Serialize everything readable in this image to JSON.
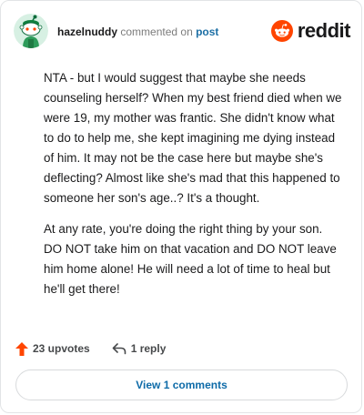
{
  "comment": {
    "username": "hazelnuddy",
    "action_text": "commented on",
    "post_link": "post",
    "paragraphs": [
      "NTA - but I would suggest that maybe she needs counseling herself? When my best friend died when we were 19, my mother was frantic. She didn't know what to do to help me, she kept imagining me dying instead of him. It may not be the case here but maybe she's deflecting? Almost like she's mad that this happened to someone her son's age..? It's a thought.",
      "At any rate, you're doing the right thing by your son. DO NOT take him on that vacation and DO NOT leave him home alone! He will need a lot of time to heal but he'll get there!"
    ],
    "upvotes_label": "23 upvotes",
    "replies_label": "1 reply",
    "view_comments_label": "View 1 comments"
  },
  "brand": {
    "wordmark": "reddit",
    "icon": "reddit-snoo-icon",
    "accent": "#ff4500"
  },
  "icons": {
    "upvote": "upvote-arrow-icon",
    "reply": "reply-arrow-icon",
    "avatar": "snoo-avatar"
  },
  "colors": {
    "upvote": "#ff4500",
    "link": "#0e6ba8",
    "text": "#1a1a1b",
    "muted": "#7c7c7c"
  }
}
